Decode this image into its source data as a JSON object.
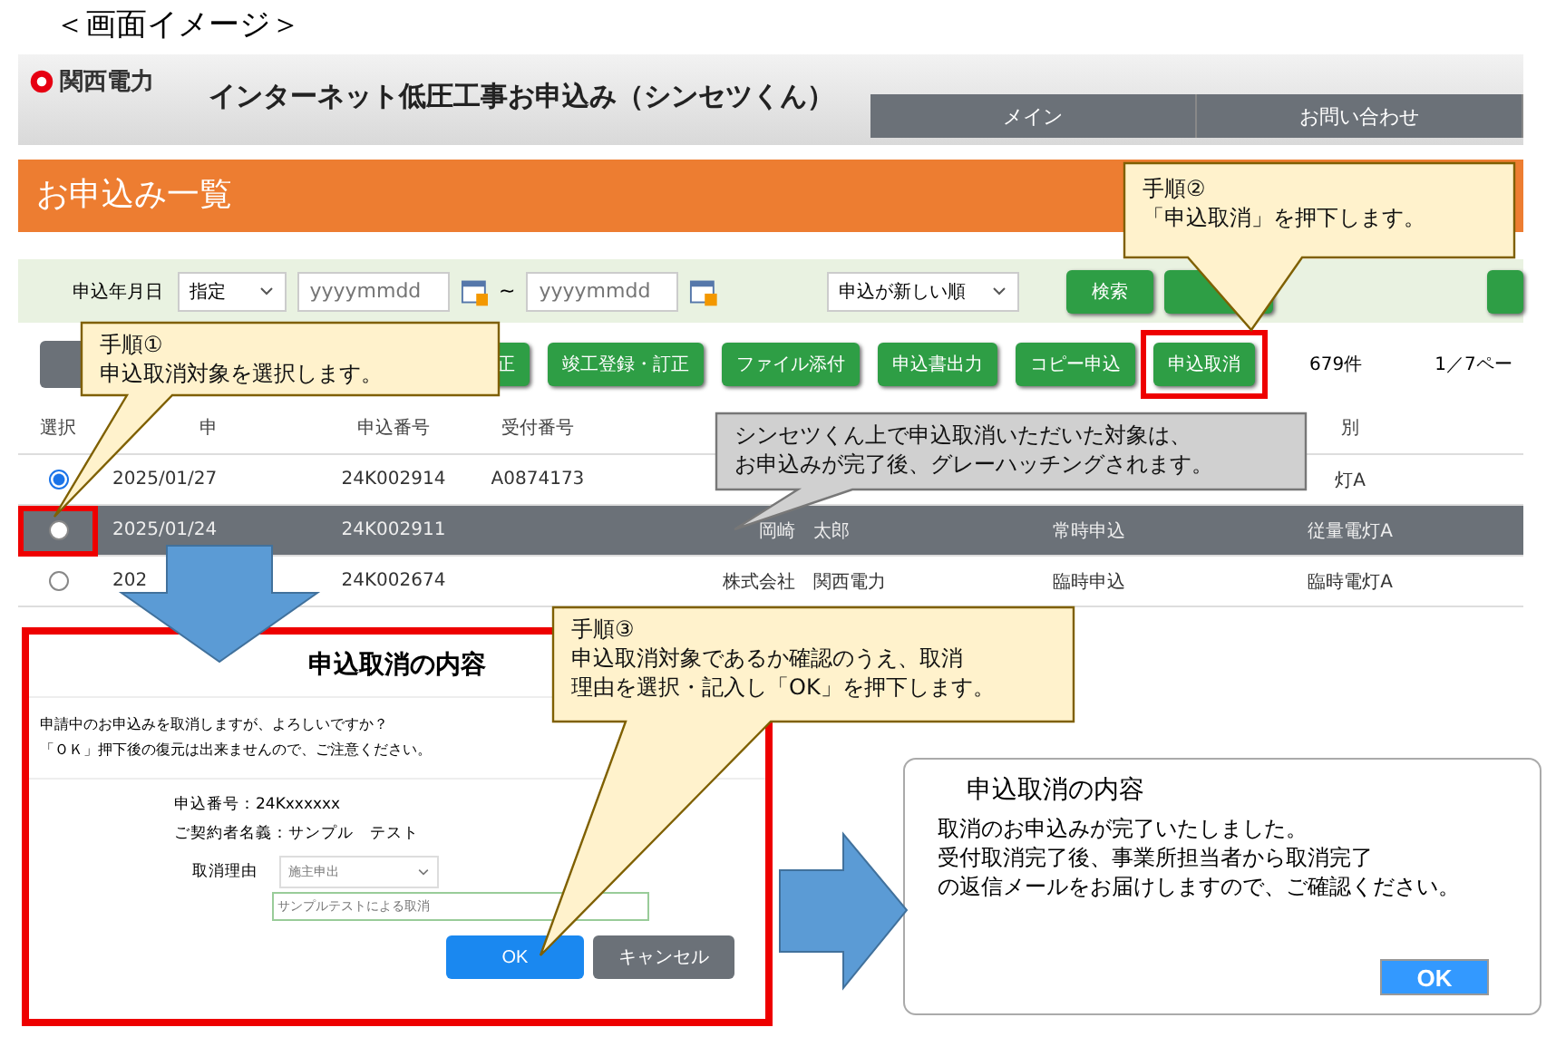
{
  "caption": "＜画面イメージ＞",
  "header": {
    "logo": "関西電力",
    "title": "インターネット低圧工事お申込み（シンセツくん）",
    "nav": [
      {
        "label": "メイン"
      },
      {
        "label": "お問い合わせ"
      }
    ]
  },
  "page_title": "お申込み一覧",
  "filter": {
    "label": "申込年月日",
    "mode": "指定",
    "from": {
      "placeholder": "yyyymmdd"
    },
    "separator": "~",
    "to": {
      "placeholder": "yyyymmdd"
    },
    "sort": "申込が新しい順",
    "search": "検索"
  },
  "actions": [
    {
      "label": "正",
      "highlighted": false
    },
    {
      "label": "竣工登録・訂正",
      "highlighted": false
    },
    {
      "label": "ファイル添付",
      "highlighted": false
    },
    {
      "label": "申込書出力",
      "highlighted": false
    },
    {
      "label": "コピー申込",
      "highlighted": false
    },
    {
      "label": "申込取消",
      "highlighted": true
    }
  ],
  "count": "679件",
  "pager": "1／7ペー",
  "table": {
    "columns": [
      "選択",
      "申",
      "申込番号",
      "受付番号",
      "",
      "",
      "別"
    ],
    "rows": [
      {
        "selected": true,
        "greyed": false,
        "highlighted": false,
        "date": "2025/01/27",
        "number": "24K002914",
        "receipt": "A0874173",
        "category": "灯A"
      },
      {
        "selected": false,
        "greyed": true,
        "highlighted": true,
        "date": "2025/01/24",
        "number": "24K002911",
        "name": "岡崎　太郎",
        "type": "常時申込",
        "category": "従量電灯A"
      },
      {
        "selected": false,
        "greyed": false,
        "highlighted": false,
        "date": "202",
        "number": "24K002674",
        "name": "株式会社　関西電力",
        "type": "臨時申込",
        "category": "臨時電灯A"
      }
    ]
  },
  "cancel_dialog": {
    "title": "申込取消の内容",
    "message": [
      "申請中のお申込みを取消しますが、よろしいですか？",
      "「ＯＫ」押下後の復元は出来ませんので、ご注意ください。"
    ],
    "number": "申込番号：24Kxxxxxx",
    "holder": "ご契約者名義：サンプル　テスト",
    "reason_label": "取消理由",
    "reason": "施主申出",
    "reason_text": "サンプルテストによる取消",
    "ok": "OK",
    "cancel": "キャンセル"
  },
  "done_dialog": {
    "title": "申込取消の内容",
    "message": [
      "取消のお申込みが完了いたしました。",
      "受付取消完了後、事業所担当者から取消完了",
      "の返信メールをお届けしますので、ご確認ください。"
    ],
    "ok": "OK"
  },
  "callouts": [
    {
      "kind": "step",
      "lines": [
        "手順①",
        "申込取消対象を選択します。"
      ]
    },
    {
      "kind": "step",
      "lines": [
        "手順②",
        "「申込取消」を押下します。"
      ]
    },
    {
      "kind": "note",
      "lines": [
        "シンセツくん上で申込取消いただいた対象は、",
        "お申込みが完了後、グレーハッチングされます。"
      ]
    },
    {
      "kind": "step",
      "lines": [
        "手順③",
        "申込取消対象であるか確認のうえ、取消",
        "理由を選択・記入し「OK」を押下します。"
      ]
    }
  ]
}
